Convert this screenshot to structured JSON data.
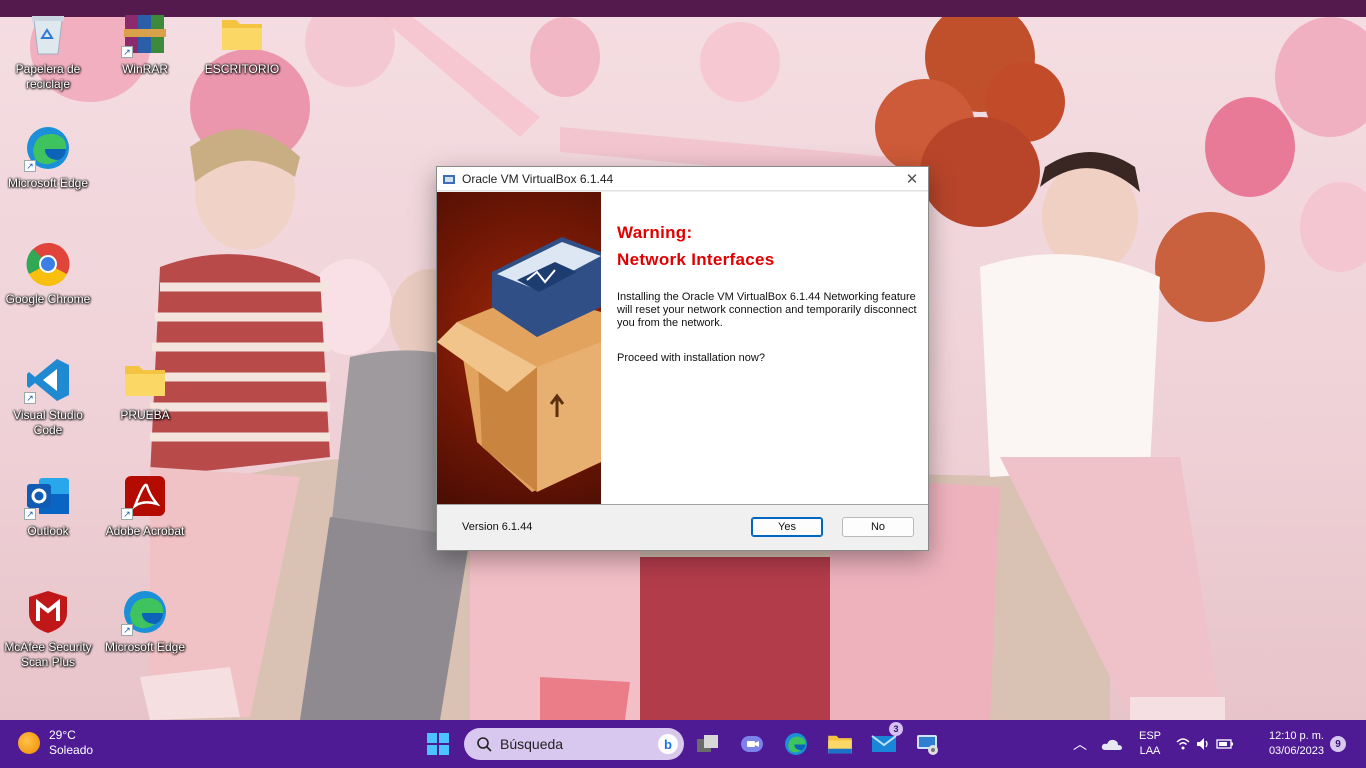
{
  "desktop": {
    "icons": [
      {
        "label": "Papelera de reciclaje",
        "icon": "recycle-bin-icon"
      },
      {
        "label": "WinRAR",
        "icon": "winrar-icon"
      },
      {
        "label": "ESCRITORIO",
        "icon": "folder-icon"
      },
      {
        "label": "Microsoft Edge",
        "icon": "edge-icon"
      },
      {
        "label": "Google Chrome",
        "icon": "chrome-icon"
      },
      {
        "label": "Visual Studio Code",
        "icon": "vscode-icon"
      },
      {
        "label": "PRUEBA",
        "icon": "folder-icon"
      },
      {
        "label": "Outlook",
        "icon": "outlook-icon"
      },
      {
        "label": "Adobe Acrobat",
        "icon": "acrobat-icon"
      },
      {
        "label": "McAfee Security Scan Plus",
        "icon": "mcafee-icon"
      },
      {
        "label": "Microsoft Edge",
        "icon": "edge-icon"
      }
    ]
  },
  "dialog": {
    "title": "Oracle VM VirtualBox 6.1.44",
    "heading_line1": "Warning:",
    "heading_line2": "Network Interfaces",
    "description": "Installing the Oracle VM VirtualBox 6.1.44 Networking feature will reset your network connection and temporarily disconnect you from the network.",
    "question": "Proceed with installation now?",
    "version": "Version 6.1.44",
    "yes_label": "Yes",
    "no_label": "No",
    "heading_color": "#e00000"
  },
  "taskbar": {
    "weather_temp": "29°C",
    "weather_desc": "Soleado",
    "search_placeholder": "Búsqueda",
    "mail_badge": "3",
    "lang_top": "ESP",
    "lang_bottom": "LAA",
    "time": "12:10 p. m.",
    "date": "03/06/2023",
    "notification_count": "9",
    "color": "#4e1b95"
  }
}
